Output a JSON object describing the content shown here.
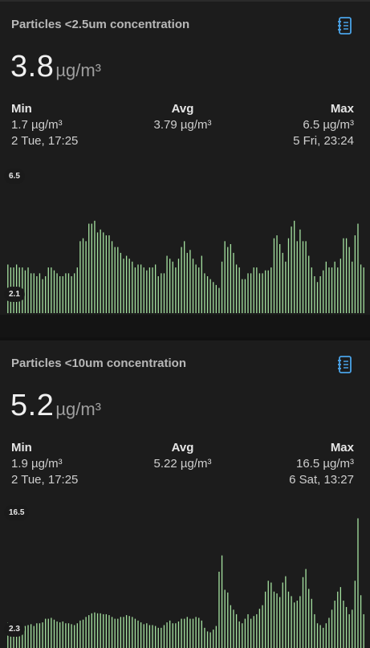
{
  "cards": [
    {
      "title": "Particles <2.5um concentration",
      "icon": "notebook-icon",
      "value": "3.8",
      "unit": "µg/m³",
      "min": {
        "label": "Min",
        "value": "1.7 µg/m³",
        "time": "2 Tue, 17:25"
      },
      "avg": {
        "label": "Avg",
        "value": "3.79 µg/m³"
      },
      "max": {
        "label": "Max",
        "value": "6.5 µg/m³",
        "time": "5 Fri, 23:24"
      },
      "chart_data": {
        "type": "bar",
        "ylim": [
          2.1,
          6.5
        ],
        "y_top_label": "6.5",
        "y_bottom_label": "2.1",
        "color": "#a6e3a1",
        "values": [
          3.6,
          3.5,
          3.5,
          3.6,
          3.5,
          3.5,
          3.4,
          3.5,
          3.3,
          3.3,
          3.2,
          3.3,
          3.1,
          3.2,
          3.5,
          3.5,
          3.4,
          3.3,
          3.2,
          3.2,
          3.3,
          3.3,
          3.2,
          3.3,
          3.5,
          4.4,
          4.5,
          4.4,
          5.0,
          5.0,
          5.1,
          4.7,
          4.8,
          4.7,
          4.6,
          4.6,
          4.4,
          4.2,
          4.2,
          4.0,
          3.8,
          3.9,
          3.8,
          3.7,
          3.5,
          3.6,
          3.6,
          3.5,
          3.4,
          3.5,
          3.5,
          3.6,
          3.2,
          3.3,
          3.3,
          3.9,
          3.8,
          3.7,
          3.5,
          3.8,
          4.2,
          4.4,
          4.0,
          4.1,
          3.8,
          3.6,
          3.5,
          3.9,
          3.3,
          3.2,
          3.1,
          3.0,
          2.9,
          2.8,
          3.7,
          4.4,
          4.2,
          4.3,
          4.0,
          3.6,
          3.5,
          3.1,
          3.1,
          3.3,
          3.3,
          3.5,
          3.5,
          3.3,
          3.3,
          3.4,
          3.4,
          3.5,
          4.5,
          4.6,
          4.3,
          4.0,
          3.7,
          4.5,
          4.9,
          5.1,
          4.4,
          4.8,
          4.4,
          4.4,
          3.9,
          3.5,
          3.2,
          3.0,
          3.2,
          3.4,
          3.7,
          3.5,
          3.5,
          3.7,
          3.5,
          3.8,
          4.5,
          4.5,
          4.2,
          3.7,
          4.6,
          5.0,
          3.6,
          3.5
        ]
      }
    },
    {
      "title": "Particles <10um concentration",
      "icon": "notebook-icon",
      "value": "5.2",
      "unit": "µg/m³",
      "min": {
        "label": "Min",
        "value": "1.9 µg/m³",
        "time": "2 Tue, 17:25"
      },
      "avg": {
        "label": "Avg",
        "value": "5.22 µg/m³"
      },
      "max": {
        "label": "Max",
        "value": "16.5 µg/m³",
        "time": "6 Sat, 13:27"
      },
      "chart_data": {
        "type": "bar",
        "ylim": [
          2.3,
          16.5
        ],
        "y_top_label": "16.5",
        "y_bottom_label": "2.3",
        "color": "#a6e3a1",
        "values": [
          4.6,
          4.3,
          4.5,
          4.3,
          4.2,
          4.0,
          4.2,
          4.3,
          4.4,
          4.2,
          4.5,
          4.5,
          4.6,
          5.0,
          5.0,
          5.1,
          4.9,
          4.7,
          4.6,
          4.7,
          4.5,
          4.5,
          4.4,
          4.3,
          4.5,
          4.8,
          4.9,
          5.2,
          5.4,
          5.6,
          5.7,
          5.6,
          5.6,
          5.5,
          5.5,
          5.4,
          5.2,
          5.0,
          5.0,
          5.2,
          5.2,
          5.4,
          5.3,
          5.2,
          5.0,
          4.8,
          4.6,
          4.4,
          4.5,
          4.3,
          4.3,
          4.2,
          4.0,
          4.0,
          4.3,
          4.6,
          4.8,
          4.5,
          4.5,
          4.7,
          5.0,
          5.0,
          5.2,
          5.0,
          5.0,
          5.2,
          5.1,
          4.8,
          4.0,
          3.6,
          3.5,
          3.8,
          4.2,
          10.2,
          12.0,
          8.2,
          7.9,
          6.5,
          6.0,
          5.5,
          4.7,
          4.5,
          5.0,
          5.5,
          5.0,
          5.3,
          5.5,
          6.1,
          6.5,
          8.0,
          9.2,
          9.0,
          8.0,
          7.8,
          7.4,
          9.0,
          9.7,
          8.0,
          7.5,
          6.8,
          7.0,
          7.5,
          9.6,
          10.5,
          8.3,
          7.2,
          5.5,
          4.5,
          4.3,
          4.0,
          4.5,
          5.1,
          6.0,
          7.0,
          8.0,
          8.5,
          7.0,
          6.3,
          5.5,
          6.0,
          9.2,
          16.1,
          7.6,
          5.5
        ]
      }
    }
  ]
}
